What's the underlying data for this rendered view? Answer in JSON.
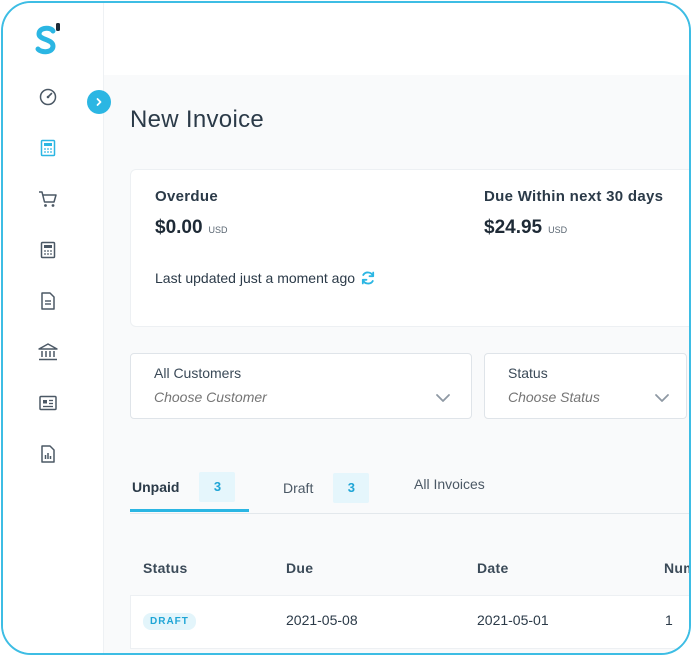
{
  "page": {
    "title": "New Invoice"
  },
  "summary": {
    "overdue_label": "Overdue",
    "overdue_amount": "$0.00",
    "overdue_currency": "USD",
    "due_label": "Due Within next 30 days",
    "due_amount": "$24.95",
    "due_currency": "USD",
    "last_updated": "Last updated just a moment ago"
  },
  "filters": {
    "customer": {
      "label": "All Customers",
      "placeholder": "Choose Customer"
    },
    "status": {
      "label": "Status",
      "placeholder": "Choose Status"
    }
  },
  "tabs": [
    {
      "label": "Unpaid",
      "count": "3",
      "active": true
    },
    {
      "label": "Draft",
      "count": "3",
      "active": false
    },
    {
      "label": "All Invoices",
      "active": false
    }
  ],
  "table": {
    "columns": [
      "Status",
      "Due",
      "Date",
      "Num"
    ],
    "rows": [
      {
        "status": "DRAFT",
        "due": "2021-05-08",
        "date": "2021-05-01",
        "number": "1"
      }
    ]
  },
  "sidebar": {
    "icons": [
      "dashboard-icon",
      "invoice-icon",
      "cart-icon",
      "calculator-icon",
      "document-icon",
      "bank-icon",
      "id-card-icon",
      "report-icon"
    ]
  },
  "colors": {
    "accent": "#2bb6e3",
    "text": "#2b3a48",
    "border": "#3dbde4"
  }
}
